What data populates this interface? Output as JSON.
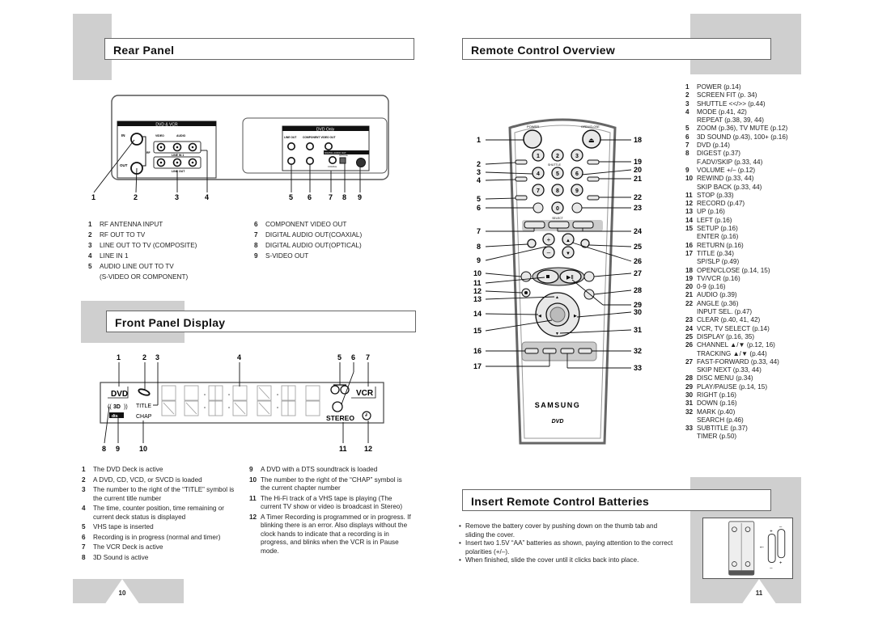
{
  "left_page": {
    "page_number": "10",
    "rear_panel": {
      "title": "Rear Panel",
      "diagram": {
        "dvd_vcr_label": "DVD & VCR",
        "dvd_only_label": "DVD Only",
        "in_label": "IN",
        "out_label": "OUT",
        "rf_label": "RF",
        "video_label": "VIDEO",
        "audio_label": "AUDIO",
        "line_in_label": "LINE IN 1",
        "line_out_label": "LINE OUT",
        "line_out_dvd_label": "LINE OUT",
        "component_label": "COMPONENT VIDEO OUT",
        "digital_audio_label": "DIGITAL AUDIO OUT",
        "svideo_label": "S-VIDEO OUT",
        "optical_label": "OPTICAL",
        "coaxial_label": "COAXIAL",
        "callouts": [
          "1",
          "2",
          "3",
          "4",
          "5",
          "6",
          "7",
          "8",
          "9"
        ]
      },
      "items": [
        {
          "n": "1",
          "text": "RF ANTENNA INPUT"
        },
        {
          "n": "2",
          "text": "RF OUT TO TV"
        },
        {
          "n": "3",
          "text": "LINE OUT TO TV (COMPOSITE)"
        },
        {
          "n": "4",
          "text": "LINE IN 1"
        },
        {
          "n": "5",
          "text": "AUDIO LINE OUT TO TV"
        },
        {
          "n": "",
          "text": "(S-VIDEO OR COMPONENT)"
        },
        {
          "n": "6",
          "text": "COMPONENT VIDEO OUT"
        },
        {
          "n": "7",
          "text": "DIGITAL AUDIO OUT(COAXIAL)"
        },
        {
          "n": "8",
          "text": "DIGITAL AUDIO OUT(OPTICAL)"
        },
        {
          "n": "9",
          "text": "S-VIDEO OUT"
        }
      ]
    },
    "front_panel": {
      "title": "Front Panel Display",
      "display": {
        "dvd": "DVD",
        "vcr": "VCR",
        "title": "TITLE",
        "chap": "CHAP",
        "stereo": "STEREO",
        "sound3d": "3D",
        "dts": "dts",
        "top_callouts": [
          "1",
          "2",
          "3",
          "4",
          "5",
          "6",
          "7"
        ],
        "bottom_callouts": [
          "8",
          "9",
          "10",
          "11",
          "12"
        ]
      },
      "items_left": [
        {
          "n": "1",
          "text": "The DVD Deck is active"
        },
        {
          "n": "2",
          "text": "A DVD, CD, VCD, or SVCD is loaded"
        },
        {
          "n": "3",
          "text": "The number to the right of the “TITLE” symbol is the current title number"
        },
        {
          "n": "4",
          "text": "The time, counter position, time remaining or current deck status is displayed"
        },
        {
          "n": "5",
          "text": "VHS tape is inserted"
        },
        {
          "n": "6",
          "text": "Recording is in progress (normal and timer)"
        },
        {
          "n": "7",
          "text": "The VCR Deck is active"
        },
        {
          "n": "8",
          "text": "3D Sound is active"
        }
      ],
      "items_right": [
        {
          "n": "9",
          "text": "A DVD with a DTS soundtrack is loaded"
        },
        {
          "n": "10",
          "text": "The number to the right of the “CHAP” symbol is the current chapter number"
        },
        {
          "n": "11",
          "text": "The Hi-Fi track of a VHS tape is playing (The current TV show or video is broadcast in Stereo)"
        },
        {
          "n": "12",
          "text": "A Timer Recording is programmed or in progress. If blinking there is an error. Also displays without the clock hands to indicate that a recording is in progress, and blinks when the VCR is in Pause mode."
        }
      ]
    }
  },
  "right_page": {
    "page_number": "11",
    "remote_overview": {
      "title": "Remote Control Overview",
      "remote": {
        "brand": "SAMSUNG",
        "power": "POWER",
        "open_close": "OPEN/CLOSE",
        "shuttle": "SHUTTLE",
        "select": "SELECT",
        "digits": [
          "1",
          "2",
          "3",
          "4",
          "5",
          "6",
          "7",
          "8",
          "9",
          "0"
        ],
        "left_callouts": [
          "1",
          "2",
          "3",
          "4",
          "5",
          "6",
          "7",
          "8",
          "9",
          "10",
          "11",
          "12",
          "13",
          "14",
          "15",
          "16",
          "17"
        ],
        "right_callouts": [
          "18",
          "19",
          "20",
          "21",
          "22",
          "23",
          "24",
          "25",
          "26",
          "27",
          "28",
          "29",
          "30",
          "31",
          "32",
          "33"
        ]
      },
      "items": [
        {
          "n": "1",
          "text": "POWER (p.14)"
        },
        {
          "n": "2",
          "text": "SCREEN FIT (p. 34)"
        },
        {
          "n": "3",
          "text": "SHUTTLE <</>> (p.44)"
        },
        {
          "n": "4",
          "text": "MODE (p.41, 42)"
        },
        {
          "n": "",
          "text": "REPEAT (p.38, 39, 44)"
        },
        {
          "n": "5",
          "text": "ZOOM (p.36), TV MUTE (p.12)"
        },
        {
          "n": "6",
          "text": "3D SOUND (p.43), 100+ (p.16)"
        },
        {
          "n": "7",
          "text": "DVD (p.14)"
        },
        {
          "n": "8",
          "text": "DIGEST (p.37)"
        },
        {
          "n": "",
          "text": "F.ADV/SKIP (p.33, 44)"
        },
        {
          "n": "9",
          "text": "VOLUME +/– (p.12)"
        },
        {
          "n": "10",
          "text": "REWIND (p.33, 44)"
        },
        {
          "n": "",
          "text": "SKIP BACK (p.33, 44)"
        },
        {
          "n": "11",
          "text": "STOP (p.33)"
        },
        {
          "n": "12",
          "text": "RECORD (p.47)"
        },
        {
          "n": "13",
          "text": "UP (p.16)"
        },
        {
          "n": "14",
          "text": "LEFT (p.16)"
        },
        {
          "n": "15",
          "text": "SETUP (p.16)"
        },
        {
          "n": "",
          "text": "ENTER (p.16)"
        },
        {
          "n": "16",
          "text": "RETURN (p.16)"
        },
        {
          "n": "17",
          "text": "TITLE (p.34)"
        },
        {
          "n": "",
          "text": "SP/SLP (p.49)"
        },
        {
          "n": "18",
          "text": "OPEN/CLOSE (p.14, 15)"
        },
        {
          "n": "19",
          "text": "TV/VCR (p.16)"
        },
        {
          "n": "20",
          "text": "0-9 (p.16)"
        },
        {
          "n": "21",
          "text": "AUDIO (p.39)"
        },
        {
          "n": "22",
          "text": "ANGLE (p.36)"
        },
        {
          "n": "",
          "text": "INPUT SEL. (p.47)"
        },
        {
          "n": "23",
          "text": "CLEAR (p.40, 41, 42)"
        },
        {
          "n": "24",
          "text": "VCR, TV SELECT (p.14)"
        },
        {
          "n": "25",
          "text": "DISPLAY (p.16, 35)"
        },
        {
          "n": "26",
          "text": "CHANNEL ▲/▼ (p.12, 16)"
        },
        {
          "n": "",
          "text": "TRACKING ▲/▼ (p.44)"
        },
        {
          "n": "27",
          "text": "FAST-FORWARD (p.33, 44)"
        },
        {
          "n": "",
          "text": "SKIP NEXT (p.33, 44)"
        },
        {
          "n": "28",
          "text": "DISC MENU (p.34)"
        },
        {
          "n": "29",
          "text": "PLAY/PAUSE (p.14, 15)"
        },
        {
          "n": "30",
          "text": "RIGHT (p.16)"
        },
        {
          "n": "31",
          "text": "DOWN (p.16)"
        },
        {
          "n": "32",
          "text": "MARK (p.40)"
        },
        {
          "n": "",
          "text": "SEARCH (p.46)"
        },
        {
          "n": "33",
          "text": "SUBTITLE (p.37)"
        },
        {
          "n": "",
          "text": "TIMER (p.50)"
        }
      ]
    },
    "batteries": {
      "title": "Insert Remote Control Batteries",
      "bullets": [
        "Remove the battery cover by pushing down on the thumb tab and sliding the cover.",
        "Insert two 1.5V “AA” batteries as shown, paying attention to the correct polarities (+/–).",
        "When finished, slide the cover until it clicks back into place."
      ]
    }
  }
}
